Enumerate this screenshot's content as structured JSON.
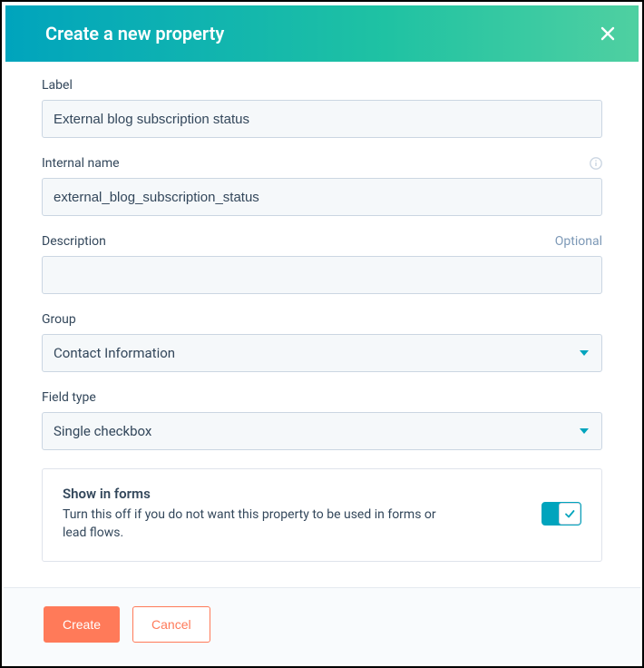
{
  "header": {
    "title": "Create a new property"
  },
  "fields": {
    "label": {
      "label": "Label",
      "value": "External blog subscription status"
    },
    "internal_name": {
      "label": "Internal name",
      "value": "external_blog_subscription_status"
    },
    "description": {
      "label": "Description",
      "optional_text": "Optional",
      "value": ""
    },
    "group": {
      "label": "Group",
      "value": "Contact Information"
    },
    "field_type": {
      "label": "Field type",
      "value": "Single checkbox"
    }
  },
  "show_in_forms": {
    "title": "Show in forms",
    "description": "Turn this off if you do not want this property to be used in forms or lead flows.",
    "enabled": true
  },
  "footer": {
    "create": "Create",
    "cancel": "Cancel"
  }
}
